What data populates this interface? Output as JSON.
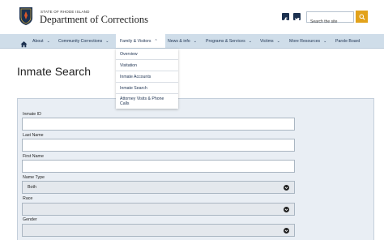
{
  "header": {
    "state_label": "STATE OF RHODE ISLAND",
    "site_name": "Department of Corrections",
    "search_placeholder": "Search the site",
    "colors": {
      "navy": "#1c3150",
      "accent": "#e2a21b"
    }
  },
  "nav": {
    "home_icon": "home-icon",
    "items": [
      {
        "label": "About"
      },
      {
        "label": "Community Corrections"
      },
      {
        "label": "Family & Visitors"
      },
      {
        "label": "News & info"
      },
      {
        "label": "Programs & Services"
      },
      {
        "label": "Victims"
      },
      {
        "label": "More Resources"
      },
      {
        "label": "Parole Board"
      }
    ]
  },
  "dropdown": {
    "items": [
      {
        "label": "Overview"
      },
      {
        "label": "Visitation"
      },
      {
        "label": "Inmate Accounts"
      },
      {
        "label": "Inmate Search"
      },
      {
        "label": "Attorney Visits & Phone Calls"
      }
    ]
  },
  "page": {
    "title": "Inmate Search"
  },
  "form": {
    "inmate_id_label": "Inmate ID",
    "last_name_label": "Last Name",
    "first_name_label": "First Name",
    "name_type_label": "Name Type",
    "name_type_value": "Both",
    "race_label": "Race",
    "race_value": "",
    "gender_label": "Gender",
    "gender_value": ""
  }
}
